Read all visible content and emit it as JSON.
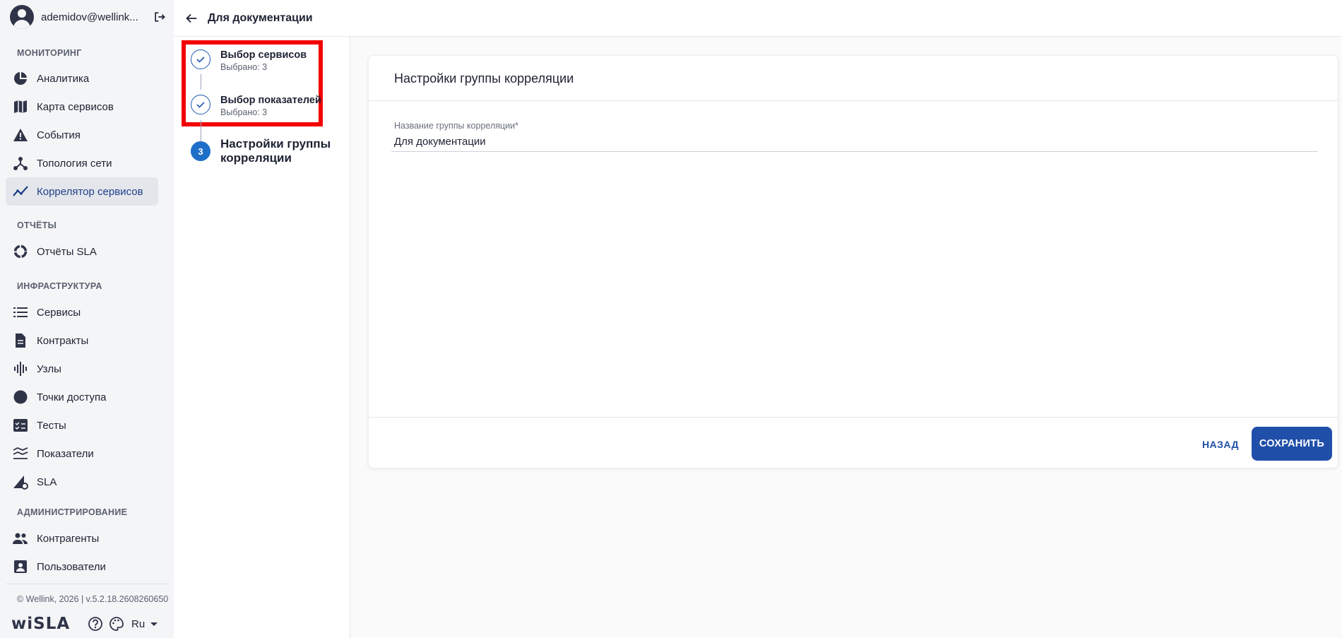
{
  "user": {
    "email": "ademidov@wellink..."
  },
  "sidebar": {
    "sections": [
      {
        "title": "МОНИТОРИНГ"
      },
      {
        "title": "ОТЧЁТЫ"
      },
      {
        "title": "ИНФРАСТРУКТУРА"
      },
      {
        "title": "АДМИНИСТРИРОВАНИЕ"
      }
    ],
    "items": [
      {
        "label": "Аналитика",
        "icon": "pie-chart-icon"
      },
      {
        "label": "Карта сервисов",
        "icon": "map-icon"
      },
      {
        "label": "События",
        "icon": "warning-icon"
      },
      {
        "label": "Топология сети",
        "icon": "topology-icon"
      },
      {
        "label": "Коррелятор сервисов",
        "icon": "trend-line-icon",
        "active": true
      },
      {
        "label": "Отчёты SLA",
        "icon": "donut-icon"
      },
      {
        "label": "Сервисы",
        "icon": "list-icon"
      },
      {
        "label": "Контракты",
        "icon": "document-icon"
      },
      {
        "label": "Узлы",
        "icon": "signal-bars-icon"
      },
      {
        "label": "Точки доступа",
        "icon": "circle-icon"
      },
      {
        "label": "Тесты",
        "icon": "checklist-icon"
      },
      {
        "label": "Показатели",
        "icon": "stacked-lines-icon"
      },
      {
        "label": "SLA",
        "icon": "sla-gear-icon"
      },
      {
        "label": "Контрагенты",
        "icon": "people-icon"
      },
      {
        "label": "Пользователи",
        "icon": "user-card-icon"
      }
    ],
    "copyright": "© Wellink, 2026 | v.5.2.18.2608260650",
    "logo": "wiSLA",
    "language": "Ru"
  },
  "header": {
    "title": "Для документации"
  },
  "stepper": {
    "steps": [
      {
        "title": "Выбор сервисов",
        "subtitle": "Выбрано: 3",
        "state": "done"
      },
      {
        "title": "Выбор показателей",
        "subtitle": "Выбрано: 3",
        "state": "done"
      },
      {
        "number": "3",
        "title_line1": "Настройки группы",
        "title_line2": "корреляции",
        "state": "current"
      }
    ]
  },
  "card": {
    "title": "Настройки группы корреляции",
    "field_label": "Название группы корреляции*",
    "field_value": "Для документации",
    "back_label": "НАЗАД",
    "save_label": "СОХРАНИТЬ"
  },
  "colors": {
    "primary": "#1f4fa8",
    "step_active": "#1f6fc9",
    "highlight": "#f20000",
    "sidebar_bg": "#f4f5f7"
  }
}
